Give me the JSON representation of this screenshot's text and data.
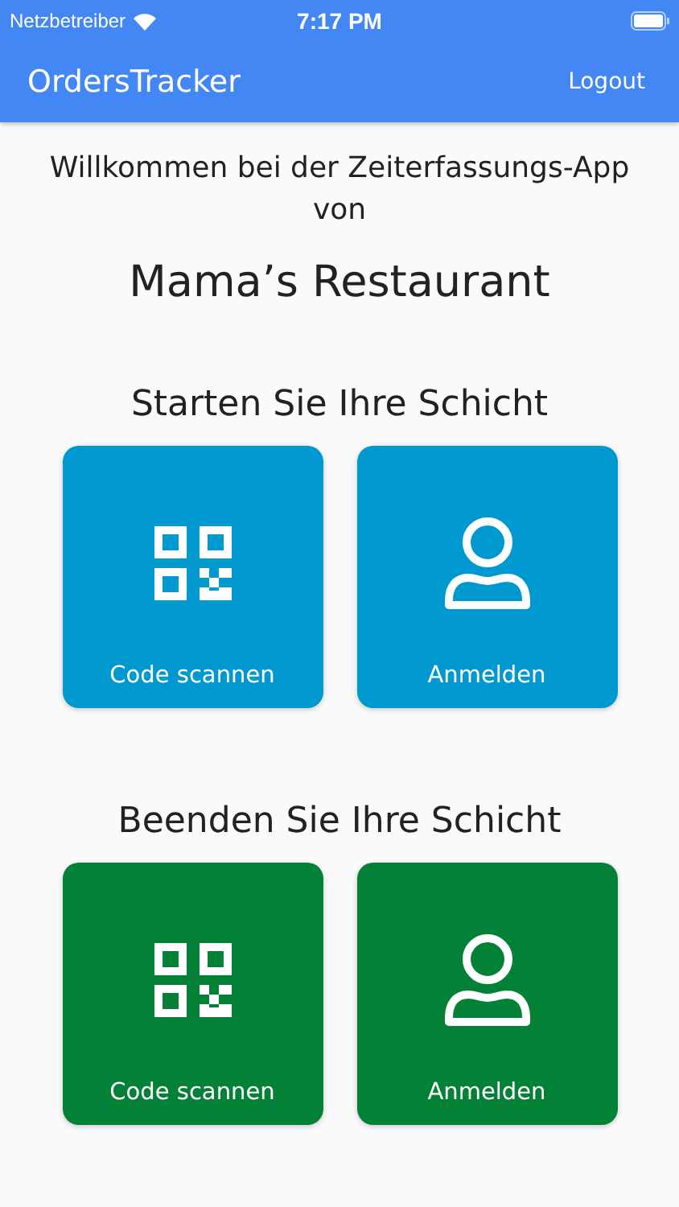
{
  "status_bar": {
    "carrier": "Netzbetreiber",
    "time": "7:17 PM"
  },
  "app_bar": {
    "title": "OrdersTracker",
    "action": "Logout"
  },
  "welcome": {
    "line": "Willkommen bei der Zeiterfassungs-App von",
    "restaurant": "Mama’s Restaurant"
  },
  "sections": [
    {
      "heading": "Starten Sie Ihre Schicht",
      "color": "#0099cf",
      "buttons": [
        {
          "kind": "qr",
          "label": "Code scannen"
        },
        {
          "kind": "person",
          "label": "Anmelden"
        }
      ]
    },
    {
      "heading": "Beenden Sie Ihre Schicht",
      "color": "#038136",
      "buttons": [
        {
          "kind": "qr",
          "label": "Code scannen"
        },
        {
          "kind": "person",
          "label": "Anmelden"
        }
      ]
    }
  ]
}
